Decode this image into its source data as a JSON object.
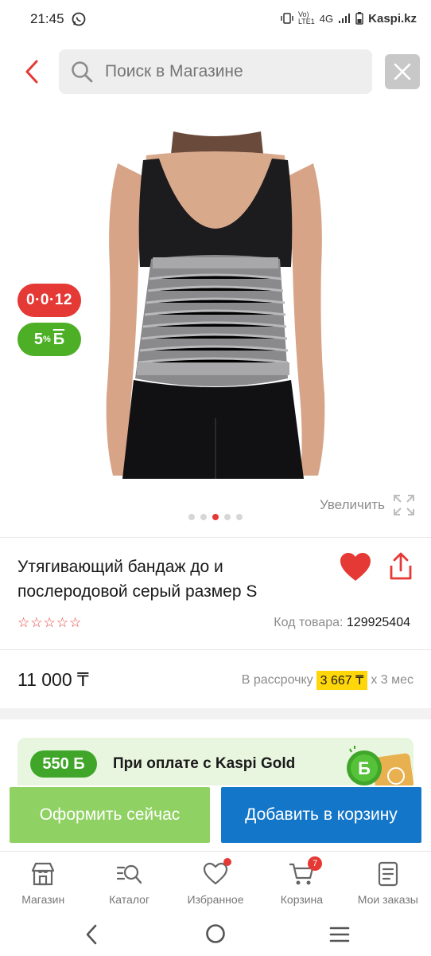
{
  "status": {
    "time": "21:45",
    "network": "4G",
    "brand": "Kaspi.kz"
  },
  "search": {
    "placeholder": "Поиск в Магазине"
  },
  "badges": {
    "installment": "0·0·12",
    "bonus_value": "5",
    "bonus_unit": "%",
    "bonus_symbol": "Б"
  },
  "gallery": {
    "zoom_label": "Увеличить",
    "dots_total": 5,
    "active_dot": 3
  },
  "product": {
    "title": "Утягивающий бандаж до и послеродовой серый размер S",
    "rating": 0,
    "sku_label": "Код товара:",
    "sku": "129925404",
    "price": "11 000 ₸",
    "installment_prefix": "В рассрочку",
    "installment_amount": "3 667 ₸",
    "installment_suffix": "х 3 мес"
  },
  "promo": {
    "badge": "550 Б",
    "text": "При оплате с Kaspi Gold"
  },
  "actions": {
    "checkout": "Оформить сейчас",
    "add_to_cart": "Добавить в корзину"
  },
  "nav": {
    "items": [
      {
        "label": "Магазин",
        "icon": "shop-icon"
      },
      {
        "label": "Каталог",
        "icon": "catalog-icon"
      },
      {
        "label": "Избранное",
        "icon": "heart-icon"
      },
      {
        "label": "Корзина",
        "icon": "cart-icon"
      },
      {
        "label": "Мои заказы",
        "icon": "orders-icon"
      }
    ],
    "cart_count": "7"
  },
  "colors": {
    "accent_red": "#e53935",
    "bonus_green": "#4caf25",
    "cart_blue": "#1476c8",
    "checkout_green": "#8fd162",
    "highlight_yellow": "#ffd60a"
  }
}
